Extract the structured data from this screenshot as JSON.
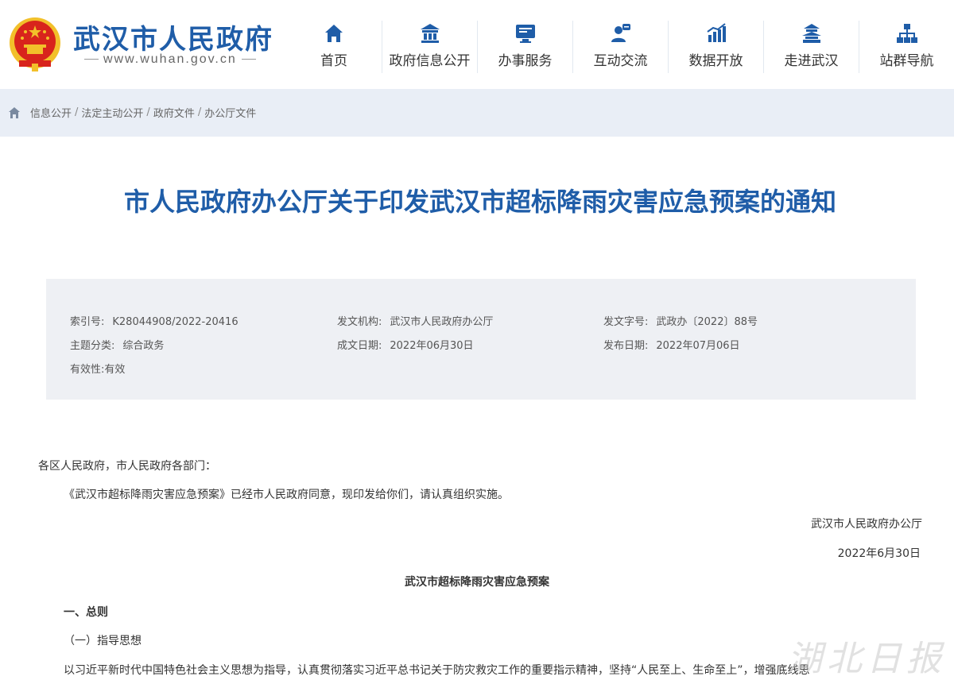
{
  "header": {
    "site_title": "武汉市人民政府",
    "site_url": "www.wuhan.gov.cn",
    "nav": [
      {
        "label": "首页",
        "icon": "home-icon"
      },
      {
        "label": "政府信息公开",
        "icon": "building-icon"
      },
      {
        "label": "办事服务",
        "icon": "monitor-icon"
      },
      {
        "label": "互动交流",
        "icon": "chat-user-icon"
      },
      {
        "label": "数据开放",
        "icon": "chart-icon"
      },
      {
        "label": "走进武汉",
        "icon": "pagoda-icon"
      },
      {
        "label": "站群导航",
        "icon": "sitemap-icon"
      }
    ],
    "colors": {
      "brand": "#1f5da8",
      "band": "#e9eef6",
      "meta_bg": "#eef0f4",
      "emblem_red": "#d8241c",
      "emblem_gold": "#f2c02a"
    }
  },
  "breadcrumb": [
    "信息公开",
    "法定主动公开",
    "政府文件",
    "办公厅文件"
  ],
  "document": {
    "title": "市人民政府办公厅关于印发武汉市超标降雨灾害应急预案的通知",
    "meta": {
      "index_label": "索引号:",
      "index_value": "K28044908/2022-20416",
      "issuer_label": "发文机构:",
      "issuer_value": "武汉市人民政府办公厅",
      "docno_label": "发文字号:",
      "docno_value": "武政办〔2022〕88号",
      "topic_label": "主题分类:",
      "topic_value": "综合政务",
      "date_made_label": "成文日期:",
      "date_made_value": "2022年06月30日",
      "date_pub_label": "发布日期:",
      "date_pub_value": "2022年07月06日",
      "validity_label": "有效性:",
      "validity_value": "有效"
    },
    "addressee": "各区人民政府，市人民政府各部门：",
    "body1": "《武汉市超标降雨灾害应急预案》已经市人民政府同意，现印发给你们，请认真组织实施。",
    "signature": "武汉市人民政府办公厅",
    "sign_date": "2022年6月30日",
    "plan_title": "武汉市超标降雨灾害应急预案",
    "section1": "一、总则",
    "subsection1": "（一）指导思想",
    "body2": "以习近平新时代中国特色社会主义思想为指导，认真贯彻落实习近平总书记关于防灾救灾工作的重要指示精神，坚持“人民至上、生命至上”，增强底线思"
  },
  "watermark": "湖北日报"
}
